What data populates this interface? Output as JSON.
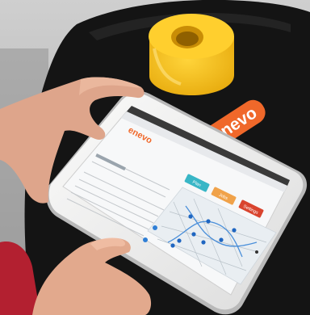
{
  "photo": {
    "logo_text": "enevo",
    "tablet_logo_text": "enevo",
    "tablet_buttons": [
      "Plan",
      "Jobs",
      "Settings"
    ],
    "colors": {
      "sensor_yellow": "#f5c21b",
      "brand_orange": "#f0682a",
      "table_black": "#141414",
      "tablet_white": "#f4f4f2",
      "btn_teal": "#38b6c6",
      "btn_orange": "#f0a24a",
      "btn_red": "#d9442e",
      "skin": "#e2a98d",
      "sleeve_red": "#b32030",
      "map_bg": "#e9eef2",
      "route_blue": "#2f7fd6"
    }
  }
}
